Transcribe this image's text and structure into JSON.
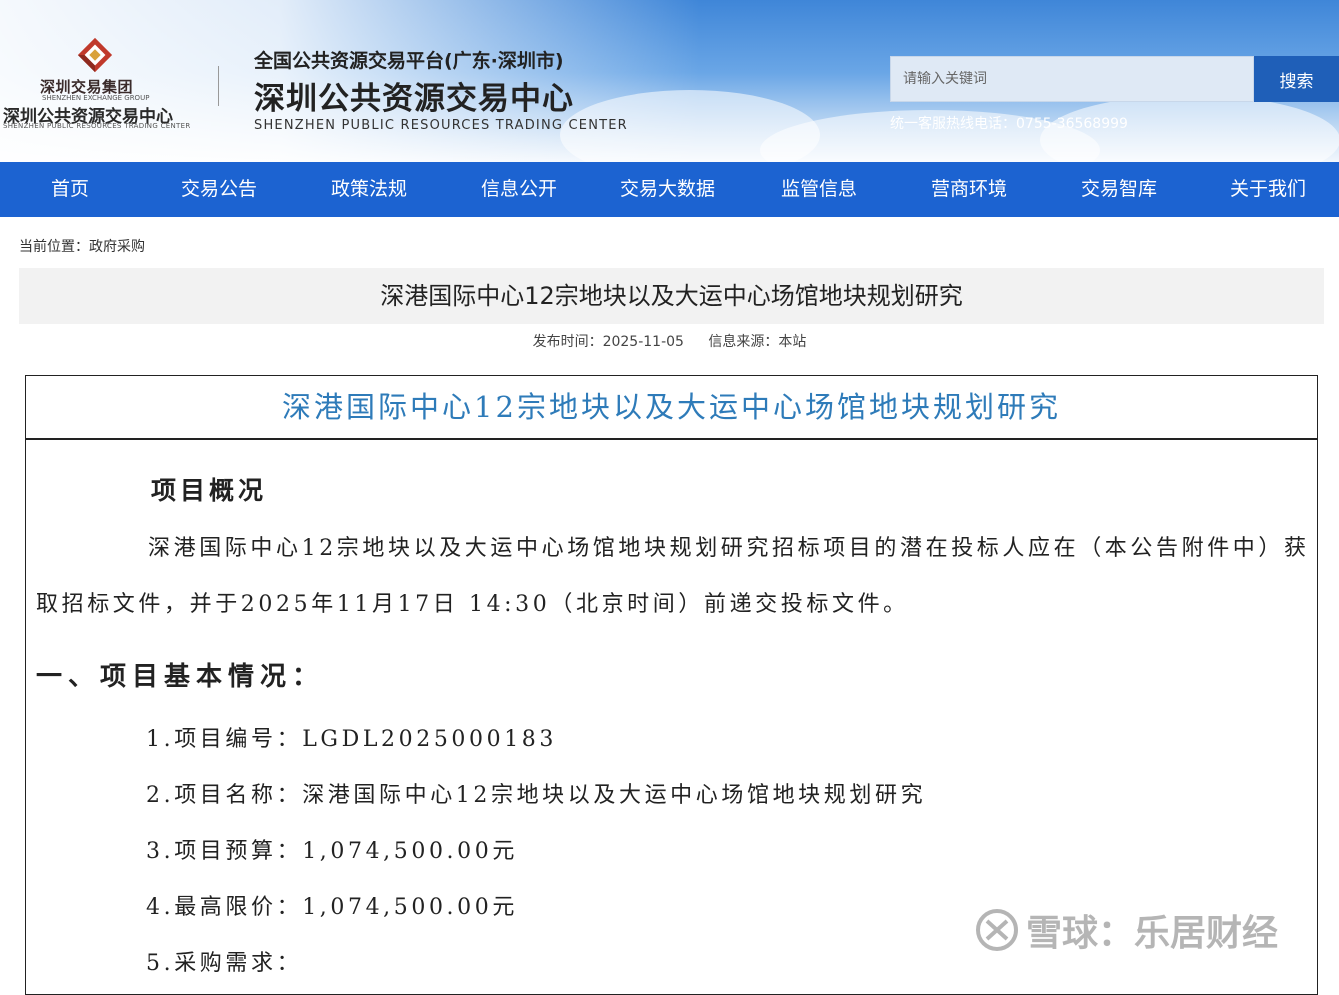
{
  "header": {
    "logo": {
      "group_cn": "深圳交易集团",
      "group_en": "SHENZHEN EXCHANGE GROUP",
      "center_cn": "深圳公共资源交易中心",
      "center_en": "SHENZHEN PUBLIC RESOURCES TRADING CENTER"
    },
    "platform_subtitle": "全国公共资源交易平台(广东·深圳市)",
    "site_title": "深圳公共资源交易中心",
    "site_title_en": "SHENZHEN PUBLIC RESOURCES TRADING CENTER",
    "search": {
      "placeholder": "请输入关键词",
      "button_label": "搜索"
    },
    "hotline": "统一客服热线电话：0755-36568999"
  },
  "nav": {
    "items": [
      "首页",
      "交易公告",
      "政策法规",
      "信息公开",
      "交易大数据",
      "监管信息",
      "营商环境",
      "交易智库",
      "关于我们"
    ]
  },
  "breadcrumb": "当前位置：政府采购",
  "article": {
    "title": "深港国际中心12宗地块以及大运中心场馆地块规划研究",
    "publish_time": "发布时间：2025-11-05",
    "source": "信息来源：本站",
    "doc_title": "深港国际中心12宗地块以及大运中心场馆地块规划研究",
    "overview_heading": "项目概况",
    "overview_text": "深港国际中心12宗地块以及大运中心场馆地块规划研究招标项目的潜在投标人应在（本公告附件中）获取招标文件，并于2025年11月17日 14:30（北京时间）前递交投标文件。",
    "section1_title": "一、项目基本情况：",
    "items": [
      "1.项目编号：LGDL2025000183",
      "2.项目名称：深港国际中心12宗地块以及大运中心场馆地块规划研究",
      "3.项目预算：1,074,500.00元",
      "4.最高限价：1,074,500.00元",
      "5.采购需求："
    ]
  },
  "watermark": "雪球：乐居财经",
  "colors": {
    "nav_bg": "#1c63d1",
    "search_button": "#1f5fb8",
    "doc_title": "#2e7bb9"
  }
}
